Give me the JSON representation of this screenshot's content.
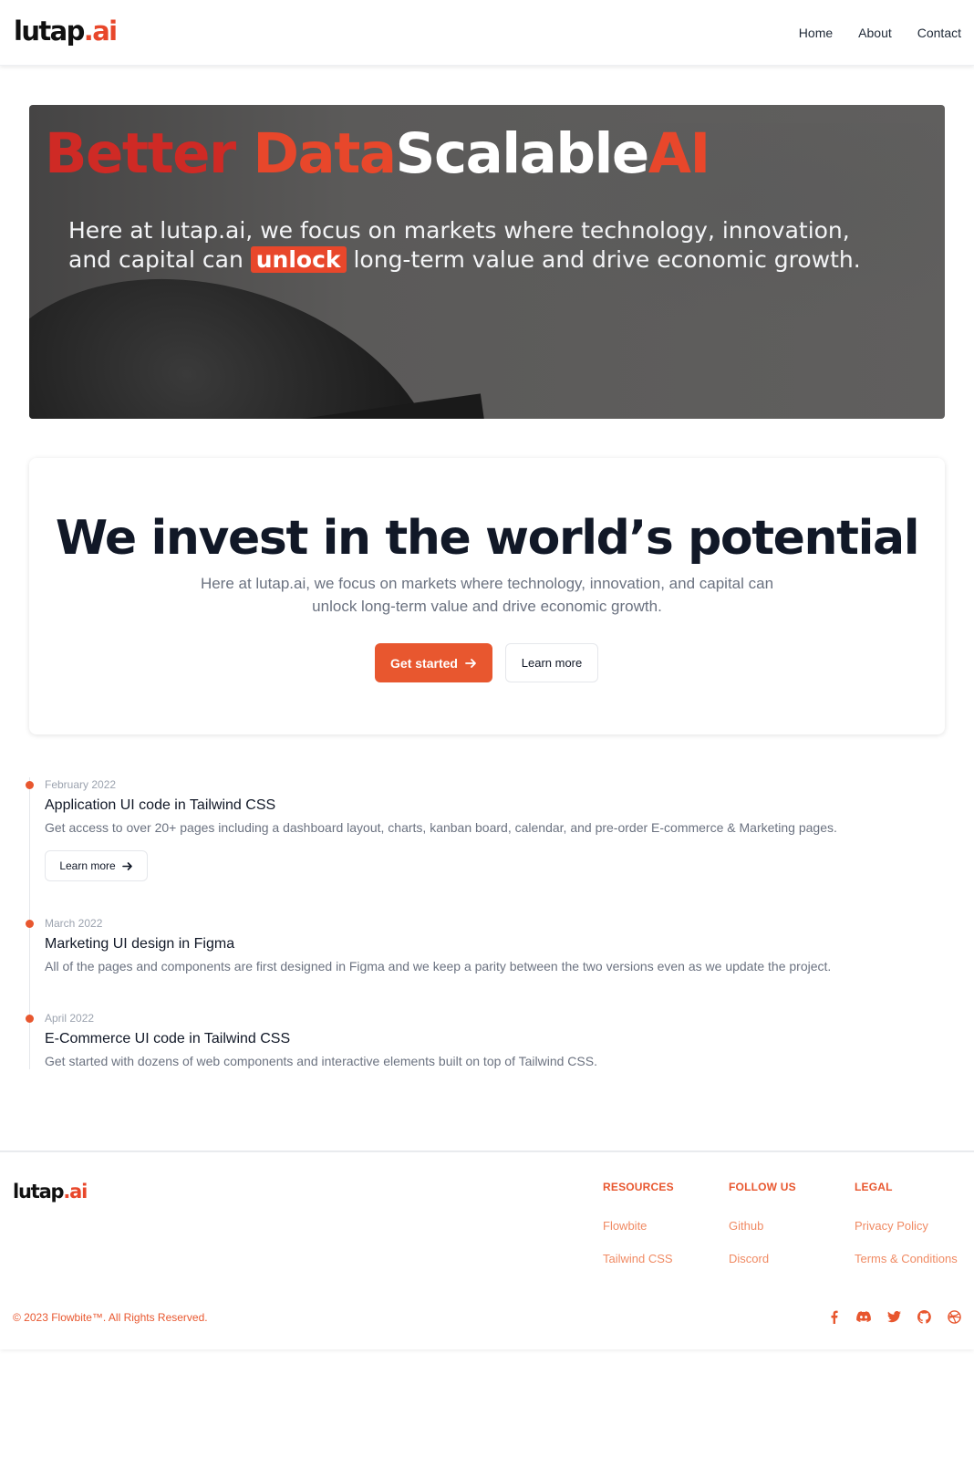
{
  "navbar": {
    "logo_main": "lutap",
    "logo_accent": ".ai",
    "links": [
      "Home",
      "About",
      "Contact"
    ]
  },
  "hero": {
    "title_part1": "Better ",
    "title_part2": "Data",
    "title_part3": "Scalable",
    "title_part4": "AI",
    "text_before": "Here at lutap.ai, we focus on markets where technology, innovation, and capital can ",
    "text_highlight": "unlock",
    "text_after": " long-term value and drive economic growth."
  },
  "invest": {
    "heading": "We invest in the world’s potential",
    "description": "Here at lutap.ai, we focus on markets where technology, innovation, and capital can unlock long-term value and drive economic growth.",
    "primary_button": "Get started",
    "secondary_button": "Learn more"
  },
  "timeline": [
    {
      "date": "February 2022",
      "title": "Application UI code in Tailwind CSS",
      "description": "Get access to over 20+ pages including a dashboard layout, charts, kanban board, calendar, and pre-order E-commerce & Marketing pages.",
      "button": "Learn more"
    },
    {
      "date": "March 2022",
      "title": "Marketing UI design in Figma",
      "description": "All of the pages and components are first designed in Figma and we keep a parity between the two versions even as we update the project."
    },
    {
      "date": "April 2022",
      "title": "E-Commerce UI code in Tailwind CSS",
      "description": "Get started with dozens of web components and interactive elements built on top of Tailwind CSS."
    }
  ],
  "footer": {
    "logo_main": "lutap",
    "logo_accent": ".ai",
    "columns": [
      {
        "heading": "RESOURCES",
        "links": [
          "Flowbite",
          "Tailwind CSS"
        ]
      },
      {
        "heading": "FOLLOW US",
        "links": [
          "Github",
          "Discord"
        ]
      },
      {
        "heading": "LEGAL",
        "links": [
          "Privacy Policy",
          "Terms & Conditions"
        ]
      }
    ],
    "copyright": "© 2023 Flowbite™. All Rights Reserved.",
    "social_icons": [
      "facebook-icon",
      "discord-icon",
      "twitter-icon",
      "github-icon",
      "dribbble-icon"
    ]
  },
  "colors": {
    "accent": "#e8572f",
    "hero_red": "#cf2a25",
    "heading": "#111827",
    "muted": "#6b7280"
  }
}
